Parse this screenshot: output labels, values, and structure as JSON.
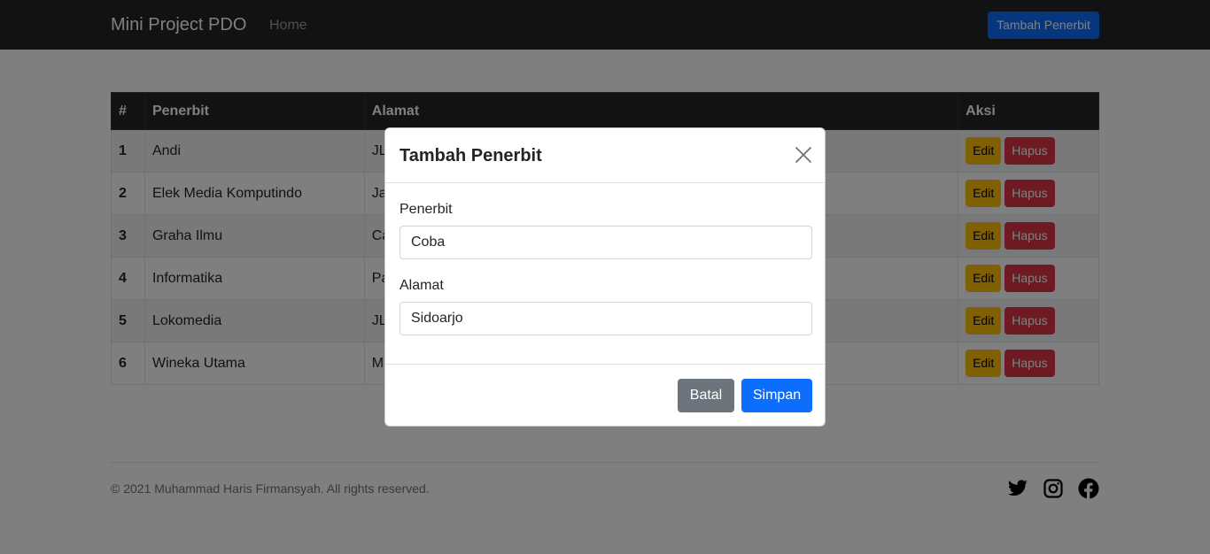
{
  "navbar": {
    "brand": "Mini Project PDO",
    "home": "Home",
    "add_button": "Tambah Penerbit"
  },
  "table": {
    "headers": [
      "#",
      "Penerbit",
      "Alamat",
      "Aksi"
    ],
    "rows": [
      {
        "no": "1",
        "penerbit": "Andi",
        "alamat": "JL"
      },
      {
        "no": "2",
        "penerbit": "Elek Media Komputindo",
        "alamat": "Ja"
      },
      {
        "no": "3",
        "penerbit": "Graha Ilmu",
        "alamat": "Ca"
      },
      {
        "no": "4",
        "penerbit": "Informatika",
        "alamat": "Pa"
      },
      {
        "no": "5",
        "penerbit": "Lokomedia",
        "alamat": "JL"
      },
      {
        "no": "6",
        "penerbit": "Wineka Utama",
        "alamat": "M"
      }
    ],
    "edit_label": "Edit",
    "delete_label": "Hapus"
  },
  "footer": {
    "copyright": "© 2021 Muhammad Haris Firmansyah. All rights reserved.",
    "social_icons": [
      "twitter-icon",
      "instagram-icon",
      "facebook-icon"
    ]
  },
  "modal": {
    "title": "Tambah Penerbit",
    "penerbit_label": "Penerbit",
    "penerbit_value": "Coba",
    "alamat_label": "Alamat",
    "alamat_value": "Sidoarjo",
    "cancel_label": "Batal",
    "save_label": "Simpan"
  },
  "colors": {
    "navbar_bg": "#212529",
    "primary": "#0d6efd",
    "warning": "#ffc107",
    "danger": "#dc3545",
    "secondary": "#6c757d"
  }
}
